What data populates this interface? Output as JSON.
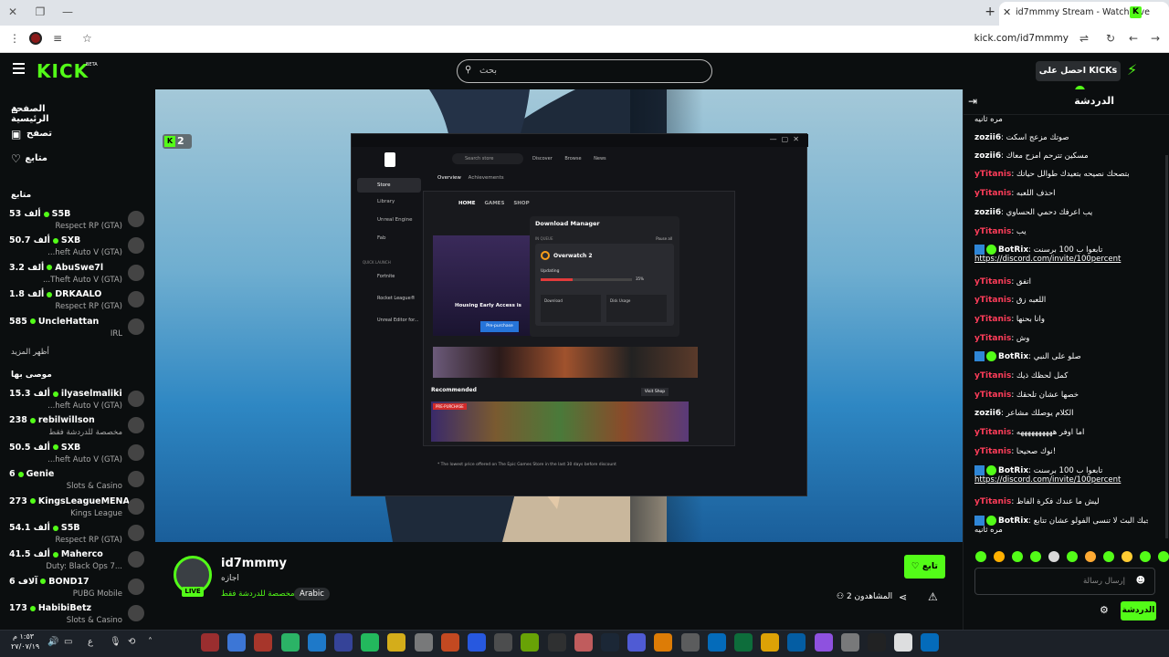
{
  "browser": {
    "tab_title": "id7mmmy Stream - Watch Live",
    "url": "kick.com/id7mmmy",
    "favicon_letter": "K"
  },
  "kick": {
    "logo": "KICK",
    "beta": "BETA",
    "search_placeholder": "بحث",
    "get_kicks": "احصل على KICKs"
  },
  "sidebar": {
    "nav": [
      {
        "label": "الصفحة الرئيسية",
        "icon": "home-icon"
      },
      {
        "label": "تصفح",
        "icon": "browse-icon"
      },
      {
        "label": "متابع",
        "icon": "heart-icon"
      }
    ],
    "following_title": "متابع",
    "following": [
      {
        "name": "S5B",
        "viewers": "53 ألف",
        "category": "Respect RP (GTA)"
      },
      {
        "name": "SXB",
        "viewers": "50.7 ألف",
        "category": "...heft Auto V (GTA)"
      },
      {
        "name": "AbuSwe7l",
        "viewers": "3.2 ألف",
        "category": "...Theft Auto V (GTA)"
      },
      {
        "name": "DRKAALO",
        "viewers": "1.8 ألف",
        "category": "Respect RP (GTA)"
      },
      {
        "name": "UncleHattan",
        "viewers": "585",
        "category": "IRL"
      }
    ],
    "show_more": "أظهر المزيد",
    "recommended_title": "موصى بها",
    "recommended": [
      {
        "name": "ilyaselmaliki",
        "viewers": "15.3 ألف",
        "category": "...heft Auto V (GTA)"
      },
      {
        "name": "rebilwillson",
        "viewers": "238",
        "category": "مخصصة للدردشة فقط"
      },
      {
        "name": "SXB",
        "viewers": "50.5 ألف",
        "category": "...heft Auto V (GTA)"
      },
      {
        "name": "Genie",
        "viewers": "6",
        "category": "Slots & Casino"
      },
      {
        "name": "KingsLeagueMENA",
        "viewers": "273",
        "category": "Kings League"
      },
      {
        "name": "S5B",
        "viewers": "54.1 ألف",
        "category": "Respect RP (GTA)"
      },
      {
        "name": "Maherco",
        "viewers": "41.5 ألف",
        "category": "Duty: Black Ops 7..."
      },
      {
        "name": "BOND17",
        "viewers": "6 آلاف",
        "category": "PUBG Mobile"
      },
      {
        "name": "HabibiBetz",
        "viewers": "173",
        "category": "Slots & Casino"
      }
    ]
  },
  "video": {
    "viewer_badge": "2",
    "epic": {
      "search": "Search store",
      "nav": [
        "Discover",
        "Browse",
        "News"
      ],
      "tabs": [
        "Overview",
        "Achievements"
      ],
      "side": [
        "Store",
        "Library",
        "Unreal Engine",
        "Fab"
      ],
      "quick_launch": "QUICK LAUNCH",
      "quick": [
        "Fortnite",
        "Rocket League®",
        "Unreal Editor for..."
      ],
      "inner_nav": [
        "HOME",
        "GAMES",
        "SHOP"
      ],
      "dm_title": "Download Manager",
      "dm_in_queue": "IN QUEUE",
      "dm_pause_all": "Pause all",
      "dm_game": "Overwatch 2",
      "dm_updating": "Updating",
      "dm_percent": "35%",
      "dm_progress": 0.35,
      "dm_download": "Download",
      "dm_disk": "Disk Usage",
      "banner_title": "Housing Early Access is",
      "banner_btn": "Pre-purchase",
      "recommended": "Recommended",
      "visit_shop": "Visit Shop",
      "pre_purchase_tag": "PRE-PURCHASE",
      "footnote": "* The lowest price offered on The Epic Games Store in the last 30 days before discount"
    }
  },
  "stream": {
    "streamer": "id7mmmy",
    "title": "اجازه",
    "live": "LIVE",
    "language": "Arabic",
    "category": "مخصصة للدردشة فقط",
    "follow": "تابع",
    "viewers": "2 المشاهدون"
  },
  "chat": {
    "title": "الدردشة",
    "messages": [
      {
        "user": "",
        "text": "مره ثانيه",
        "color": "white",
        "bot": false
      },
      {
        "user": "zozii6",
        "text": "صوتك مزعج اسكت",
        "color": "white",
        "bot": false
      },
      {
        "user": "zozii6",
        "text": "مسكين تترحم امزح معاك",
        "color": "white",
        "bot": false
      },
      {
        "user": "yTitanis",
        "text": "بتصحك نصيحه بتعيدك طوالل حياتك",
        "color": "red",
        "bot": false
      },
      {
        "user": "yTitanis",
        "text": "احذف اللعبه",
        "color": "red",
        "bot": false
      },
      {
        "user": "zozii6",
        "text": "يب اعرفك دحمي الحساوي",
        "color": "white",
        "bot": false
      },
      {
        "user": "yTitanis",
        "text": "يب",
        "color": "red",
        "bot": false
      },
      {
        "user": "BotRix",
        "text": "تابعوا ب 100 برسنت",
        "color": "green",
        "bot": true,
        "link": "https://discord.com/invite/100percent"
      },
      {
        "user": "yTitanis",
        "text": "اتفق",
        "color": "red",
        "bot": false
      },
      {
        "user": "yTitanis",
        "text": "اللعبه زق",
        "color": "red",
        "bot": false
      },
      {
        "user": "yTitanis",
        "text": "وانا بحنها",
        "color": "red",
        "bot": false
      },
      {
        "user": "yTitanis",
        "text": "وش",
        "color": "red",
        "bot": false
      },
      {
        "user": "BotRix",
        "text": "صلو على النبي",
        "color": "green",
        "bot": true
      },
      {
        "user": "yTitanis",
        "text": "كمل لحظك ذيك",
        "color": "red",
        "bot": false
      },
      {
        "user": "yTitanis",
        "text": "خصها عشان تلحقك",
        "color": "red",
        "bot": false
      },
      {
        "user": "zozii6",
        "text": "الكلام يوصلك مشاعر",
        "color": "white",
        "bot": false
      },
      {
        "user": "yTitanis",
        "text": "اما اوفر ههههههههههه",
        "color": "red",
        "bot": false
      },
      {
        "user": "yTitanis",
        "text": "نوك صحيحا!",
        "color": "red",
        "bot": false
      },
      {
        "user": "BotRix",
        "text": "تابعوا ب 100 برسنت",
        "color": "green",
        "bot": true,
        "link": "https://discord.com/invite/100percent"
      },
      {
        "user": "yTitanis",
        "text": "ليش ما عندك فكرة الفاظ",
        "color": "red",
        "bot": false
      },
      {
        "user": "BotRix",
        "text": "اذا اعجبك البث لا تنسى الفولو عشان تتابع",
        "color": "green",
        "bot": true,
        "second": "مره ثانيه"
      }
    ],
    "input_placeholder": "إرسال رسالة",
    "send": "الدردشة"
  },
  "taskbar": {
    "time": "١:٥٣ م",
    "date": "٢٧/٠٧/١٩",
    "lang": "ع"
  }
}
